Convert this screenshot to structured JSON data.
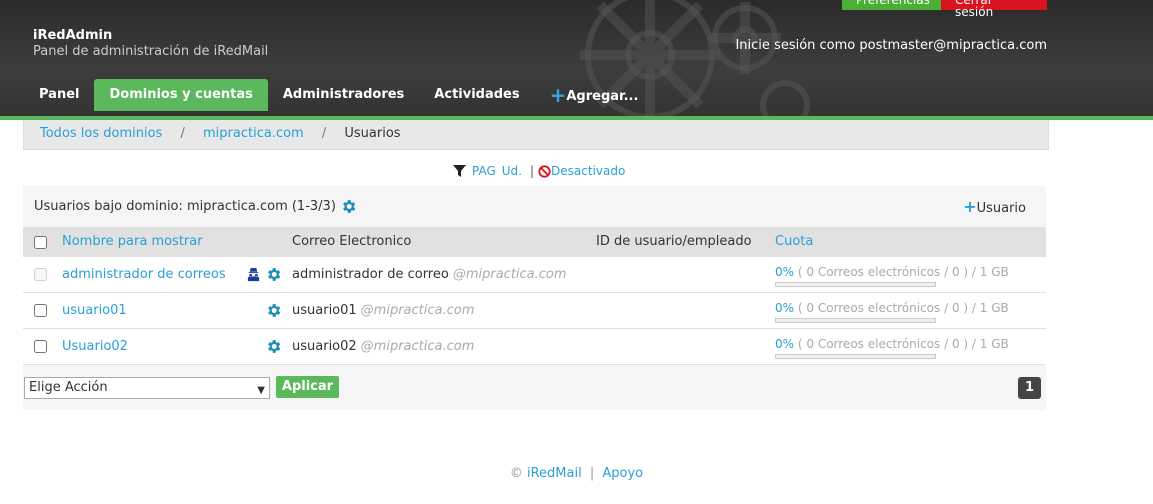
{
  "header": {
    "title": "iRedAdmin",
    "subtitle": "Panel de administración de iRedMail",
    "preferences_label": "Preferencias",
    "logout_label": "Cerrar sesión",
    "login_info": "Inicie sesión como postmaster@mipractica.com"
  },
  "nav": {
    "items": [
      {
        "label": "Panel"
      },
      {
        "label": "Dominios y cuentas"
      },
      {
        "label": "Administradores"
      },
      {
        "label": "Actividades"
      },
      {
        "label": "Agregar..."
      }
    ]
  },
  "breadcrumb": {
    "all_domains": "Todos los dominios",
    "domain": "mipractica.com",
    "current": "Usuarios",
    "separator": "/"
  },
  "filter": {
    "pag": "PAG",
    "ud": "Ud.",
    "separator": "|",
    "disabled": "Desactivado"
  },
  "panel": {
    "title": "Usuarios bajo dominio: mipractica.com (1-3/3)",
    "add_user": "Usuario"
  },
  "table": {
    "columns": {
      "display_name": "Nombre para mostrar",
      "email": "Correo Electronico",
      "user_id": "ID de usuario/empleado",
      "quota": "Cuota"
    },
    "rows": [
      {
        "name": "administrador de correos",
        "email_user": "administrador de correo",
        "email_domain": "@mipractica.com",
        "user_id": "",
        "quota_pct": "0%",
        "quota_detail": "( 0 Correos electrónicos / 0 ) / 1 GB",
        "is_admin": true
      },
      {
        "name": "usuario01",
        "email_user": "usuario01",
        "email_domain": "@mipractica.com",
        "user_id": "",
        "quota_pct": "0%",
        "quota_detail": "( 0 Correos electrónicos / 0 ) / 1 GB",
        "is_admin": false
      },
      {
        "name": "Usuario02",
        "email_user": "usuario02",
        "email_domain": "@mipractica.com",
        "user_id": "",
        "quota_pct": "0%",
        "quota_detail": "( 0 Correos electrónicos / 0 ) / 1 GB",
        "is_admin": false
      }
    ]
  },
  "actions": {
    "select_value": "Elige Acción",
    "apply_label": "Aplicar",
    "page": "1"
  },
  "footer": {
    "copyright": "©",
    "brand": "iRedMail",
    "separator": "|",
    "support": "Apoyo"
  },
  "colors": {
    "accent_green": "#5cb85c",
    "link_blue": "#2a9fd6",
    "logout_red": "#d9141e"
  }
}
